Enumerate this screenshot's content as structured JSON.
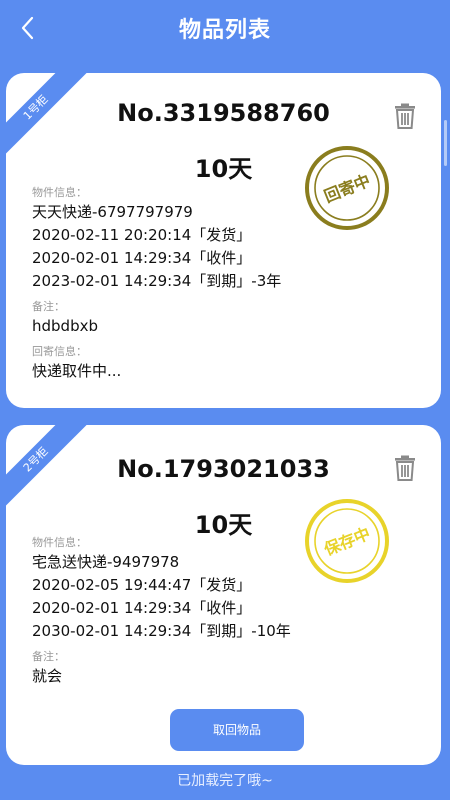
{
  "header": {
    "title": "物品列表"
  },
  "items": [
    {
      "cabinet": "1号柜",
      "tracking_no": "No.3319588760",
      "days": "10天",
      "stamp_text": "回寄中",
      "stamp_color": "#8a7d1e",
      "info_label": "物件信息：",
      "courier": "天天快递-6797797979",
      "ship_line": "2020-02-11 20:20:14「发货」",
      "receive_line": "2020-02-01 14:29:34「收件」",
      "expire_line": "2023-02-01 14:29:34「到期」-3年",
      "note_label": "备注：",
      "note": "hdbdbxb",
      "return_label": "回寄信息：",
      "return_info": "快递取件中..."
    },
    {
      "cabinet": "2号柜",
      "tracking_no": "No.1793021033",
      "days": "10天",
      "stamp_text": "保存中",
      "stamp_color": "#e8d32a",
      "info_label": "物件信息：",
      "courier": "宅急送快递-9497978",
      "ship_line": "2020-02-05 19:44:47「发货」",
      "receive_line": "2020-02-01 14:29:34「收件」",
      "expire_line": "2030-02-01 14:29:34「到期」-10年",
      "note_label": "备注：",
      "note": "就会",
      "button_label": "取回物品"
    }
  ],
  "footer": {
    "text": "已加载完了哦~"
  },
  "colors": {
    "background": "#5a8cf0",
    "card": "#ffffff",
    "button": "#5a8cf0"
  }
}
